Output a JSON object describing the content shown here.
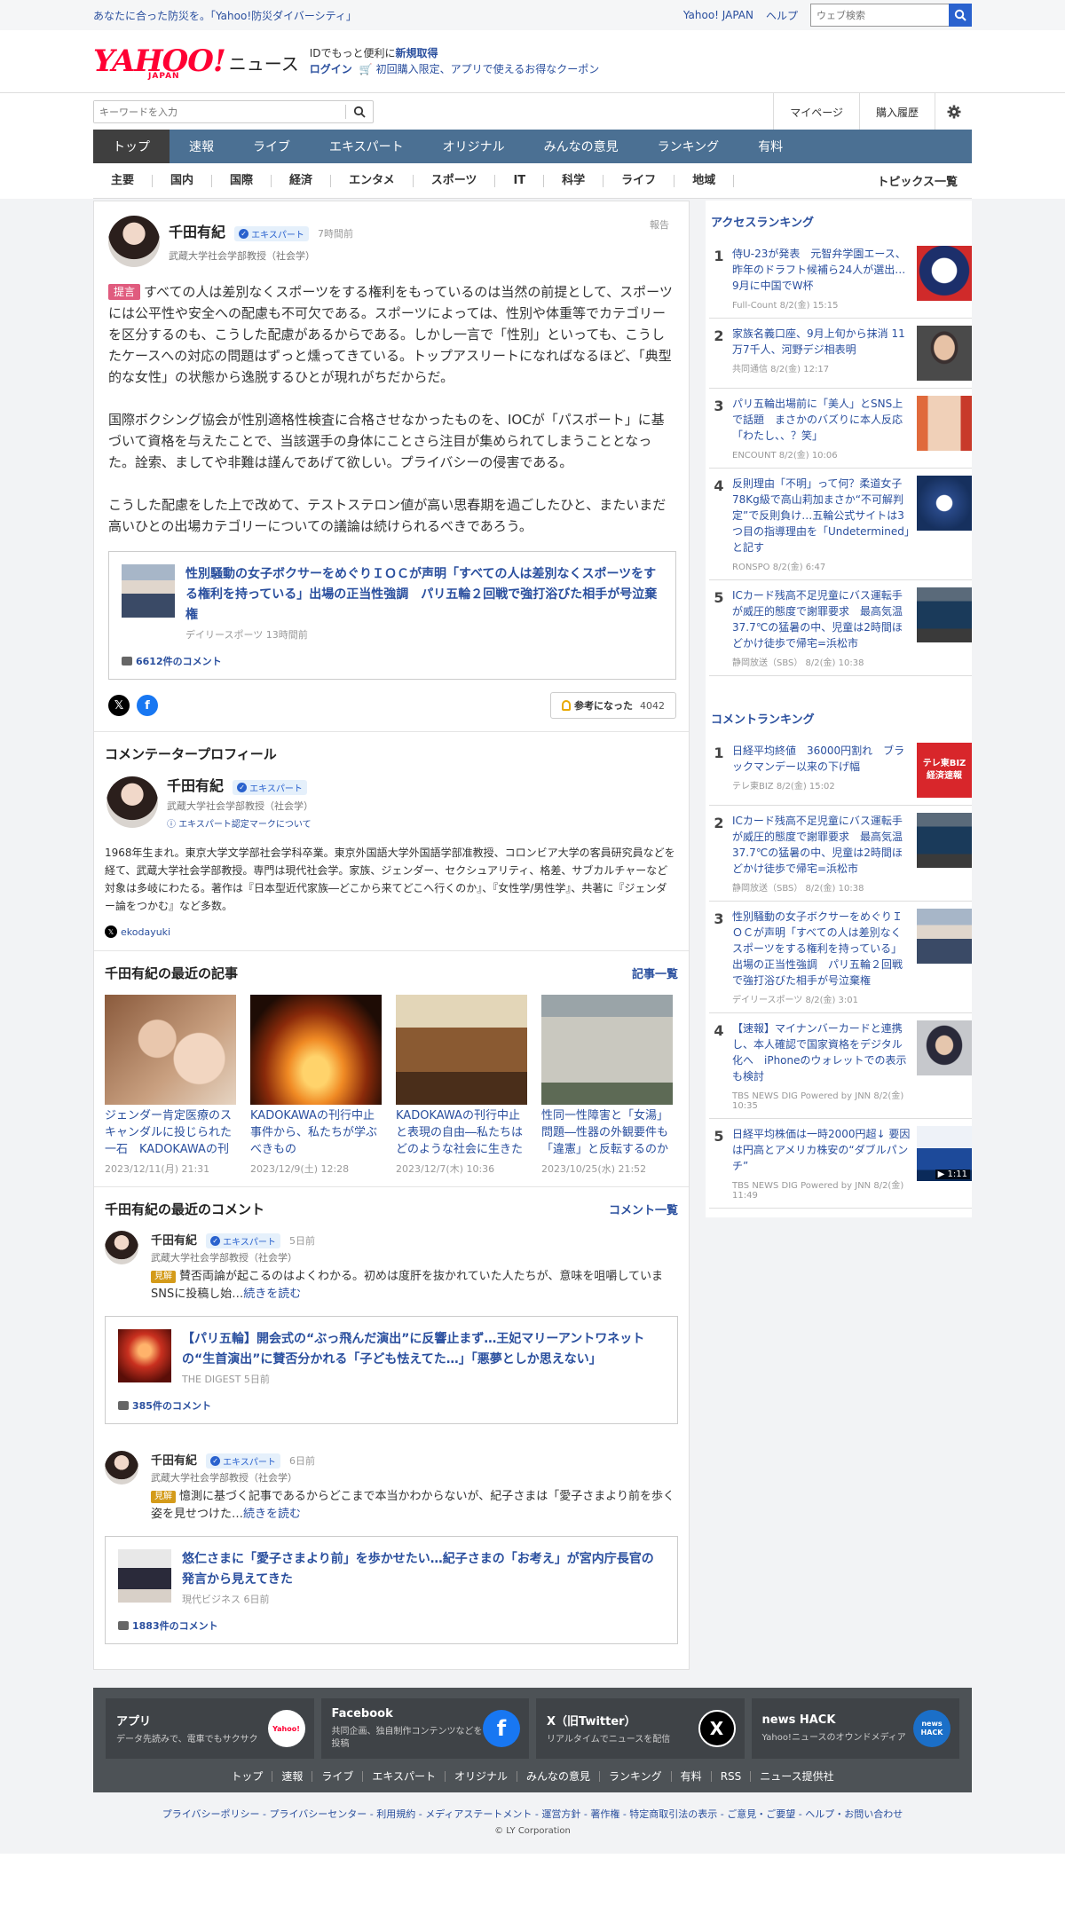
{
  "topbar": {
    "promo": "あなたに合った防災を。「Yahoo!防災ダイバーシティ」",
    "yahoo_japan": "Yahoo! JAPAN",
    "help": "ヘルプ",
    "web_search_placeholder": "ウェブ検索"
  },
  "header": {
    "logo_text": "YAHOO!",
    "logo_sub": "JAPAN",
    "logo_news": "ニュース",
    "id_prefix": "IDでもっと便利に",
    "new_signup": "新規取得",
    "login": "ログイン",
    "coupon": "初回購入限定、アプリで使えるお得なクーポン"
  },
  "search": {
    "placeholder": "キーワードを入力",
    "mypage": "マイページ",
    "history": "購入履歴"
  },
  "main_nav": [
    "トップ",
    "速報",
    "ライブ",
    "エキスパート",
    "オリジナル",
    "みんなの意見",
    "ランキング",
    "有料"
  ],
  "sub_nav": [
    "主要",
    "国内",
    "国際",
    "経済",
    "エンタメ",
    "スポーツ",
    "IT",
    "科学",
    "ライフ",
    "地域"
  ],
  "topics_all": "トピックス一覧",
  "comment": {
    "author": "千田有紀",
    "badge": "エキスパート",
    "ago": "7時間前",
    "report": "報告",
    "affiliation": "武蔵大学社会学部教授（社会学）",
    "tag": "提言",
    "p1": "すべての人は差別なくスポーツをする権利をもっているのは当然の前提として、スポーツには公平性や安全への配慮も不可欠である。スポーツによっては、性別や体重等でカテゴリーを区分するのも、こうした配慮があるからである。しかし一言で「性別」といっても、こうしたケースへの対応の問題はずっと燻ってきている。トップアスリートになればなるほど、「典型的な女性」の状態から逸脱するひとが現れがちだからだ。",
    "p2": "国際ボクシング協会が性別適格性検査に合格させなかったものを、IOCが「パスポート」に基づいて資格を与えたことで、当該選手の身体にことさら注目が集められてしまうこととなった。詮索、ましてや非難は謹んであげて欲しい。プライバシーの侵害である。",
    "p3": "こうした配慮をした上で改めて、テストステロン値が高い思春期を過ごしたひと、またいまだ高いひとの出場カテゴリーについての議論は続けられるべきであろう。",
    "article_title": "性別騒動の女子ボクサーをめぐりＩＯＣが声明「すべての人は差別なくスポーツをする権利を持っている」出場の正当性強調　パリ五輪２回戦で強打浴びた相手が号泣棄権",
    "article_source": "デイリースポーツ 13時間前",
    "article_comments": "6612件のコメント",
    "helpful_label": "参考になった",
    "helpful_count": "4042"
  },
  "profile": {
    "heading": "コメンテータープロフィール",
    "name": "千田有紀",
    "badge": "エキスパート",
    "affiliation": "武蔵大学社会学部教授（社会学）",
    "cert": "エキスパート認定マークについて",
    "bio": "1968年生まれ。東京大学文学部社会学科卒業。東京外国語大学外国語学部准教授、コロンビア大学の客員研究員などを経て、武蔵大学社会学部教授。専門は現代社会学。家族、ジェンダー、セクシュアリティ、格差、サブカルチャーなど対象は多岐にわたる。著作は『日本型近代家族―どこから来てどこへ行くのか』、『女性学/男性学』、共著に『ジェンダー論をつかむ』など多数。",
    "x_handle": "ekodayuki"
  },
  "recent_articles": {
    "heading": "千田有紀の最近の記事",
    "more": "記事一覧",
    "items": [
      {
        "title": "ジェンダー肯定医療のスキャンダルに投じられた一石　KADOKAWAの刊行中止",
        "date": "2023/12/11(月) 21:31"
      },
      {
        "title": "KADOKAWAの刊行中止事件から、私たちが学ぶべきもの",
        "date": "2023/12/9(土) 12:28"
      },
      {
        "title": "KADOKAWAの刊行中止と表現の自由―私たちはどのような社会に生きたいのか",
        "date": "2023/12/7(木) 10:36"
      },
      {
        "title": "性同一性障害と「女湯」問題―性器の外観要件も「違憲」と反転するのか",
        "date": "2023/10/25(水) 21:52"
      }
    ]
  },
  "recent_comments": {
    "heading": "千田有紀の最近のコメント",
    "more": "コメント一覧",
    "items": [
      {
        "name": "千田有紀",
        "badge": "エキスパート",
        "ago": "5日前",
        "affiliation": "武蔵大学社会学部教授（社会学）",
        "tag": "見解",
        "text": "賛否両論が起こるのはよくわかる。初めは度肝を抜かれていた人たちが、意味を咀嚼していまSNSに投稿し始…",
        "more": "続きを読む",
        "article_title": "【パリ五輪】開会式の“ぶっ飛んだ演出”に反響止まず…王妃マリーアントワネットの“生首演出”に賛否分かれる「子ども怯えてた…」「悪夢としか思えない」",
        "article_source": "THE DIGEST 5日前",
        "article_comments": "385件のコメント"
      },
      {
        "name": "千田有紀",
        "badge": "エキスパート",
        "ago": "6日前",
        "affiliation": "武蔵大学社会学部教授（社会学）",
        "tag": "見解",
        "text": "憶測に基づく記事であるからどこまで本当かわからないが、紀子さまは「愛子さまより前を歩く姿を見せつけた…",
        "more": "続きを読む",
        "article_title": "悠仁さまに「愛子さまより前」を歩かせたい…紀子さまの「お考え」が宮内庁長官の発言から見えてきた",
        "article_source": "現代ビジネス 6日前",
        "article_comments": "1883件のコメント"
      }
    ]
  },
  "access_ranking": {
    "heading": "アクセスランキング",
    "items": [
      {
        "no": "1",
        "title": "侍U-23が発表　元智弁学園エース、昨年のドラフト候補ら24人が選出…9月に中国でW杯",
        "source": "Full-Count 8/2(金) 15:15"
      },
      {
        "no": "2",
        "title": "家族名義口座、9月上旬から抹消 11万7千人、河野デジ相表明",
        "source": "共同通信 8/2(金) 12:17"
      },
      {
        "no": "3",
        "title": "パリ五輪出場前に「美人」とSNS上で話題　まさかのバズりに本人反応「わたし、、？笑」",
        "source": "ENCOUNT 8/2(金) 10:06"
      },
      {
        "no": "4",
        "title": "反則理由「不明」って何？柔道女子78Kg級で高山莉加まさか“不可解判定”で反則負け…五輪公式サイトは3つ目の指導理由を「Undetermined」と記す",
        "source": "RONSPO 8/2(金) 6:47"
      },
      {
        "no": "5",
        "title": "ICカード残高不足児童にバス運転手が威圧的態度で謝罪要求　最高気温37.7℃の猛暑の中、児童は2時間ほどかけ徒歩で帰宅=浜松市",
        "source": "静岡放送（SBS） 8/2(金) 10:38"
      }
    ]
  },
  "comment_ranking": {
    "heading": "コメントランキング",
    "items": [
      {
        "no": "1",
        "title": "日経平均終値　36000円割れ　ブラックマンデー以来の下げ幅",
        "source": "テレ東BIZ 8/2(金) 15:02"
      },
      {
        "no": "2",
        "title": "ICカード残高不足児童にバス運転手が威圧的態度で謝罪要求　最高気温37.7℃の猛暑の中、児童は2時間ほどかけ徒歩で帰宅=浜松市",
        "source": "静岡放送（SBS） 8/2(金) 10:38"
      },
      {
        "no": "3",
        "title": "性別騒動の女子ボクサーをめぐりＩＯＣが声明「すべての人は差別なくスポーツをする権利を持っている」出場の正当性強調　パリ五輪２回戦で強打浴びた相手が号泣棄権",
        "source": "デイリースポーツ 8/2(金) 3:01"
      },
      {
        "no": "4",
        "title": "【速報】マイナンバーカードと連携し、本人確認で国家資格をデジタル化へ　iPhoneのウォレットでの表示も検討",
        "source": "TBS NEWS DIG Powered by JNN 8/2(金) 10:35"
      },
      {
        "no": "5",
        "title": "日経平均株価は一時2000円超↓ 要因は円高とアメリカ株安の“ダブルパンチ”",
        "source": "TBS NEWS DIG Powered by JNN 8/2(金) 11:49"
      }
    ],
    "thumb_label_1": "テレ東BIZ 経済速報",
    "video_time": "1:11"
  },
  "footer": {
    "cards": [
      {
        "title": "アプリ",
        "desc": "データ先読みで、電車でもサクサク",
        "icon": "Yahoo!"
      },
      {
        "title": "Facebook",
        "desc": "共同企画、独自制作コンテンツなどを投稿",
        "icon": "f"
      },
      {
        "title": "X（旧Twitter）",
        "desc": "リアルタイムでニュースを配信",
        "icon": "X"
      },
      {
        "title": "news HACK",
        "desc": "Yahoo!ニュースのオウンドメディア",
        "icon": "news HACK"
      }
    ],
    "links": [
      "トップ",
      "速報",
      "ライブ",
      "エキスパート",
      "オリジナル",
      "みんなの意見",
      "ランキング",
      "有料",
      "RSS",
      "ニュース提供社"
    ],
    "legal": "プライバシーポリシー - プライバシーセンター - 利用規約 - メディアステートメント - 運営方針 - 著作権 - 特定商取引法の表示 - ご意見・ご要望 - ヘルプ・お問い合わせ",
    "copyright": "© LY Corporation"
  },
  "colors": {
    "brand_red": "#ff0033",
    "nav_blue": "#4b7093",
    "link_blue": "#2a4f9e",
    "proposal_pink": "#e05b7e"
  }
}
